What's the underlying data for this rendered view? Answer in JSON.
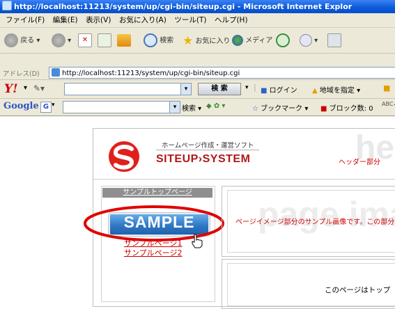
{
  "window": {
    "title": "http://localhost:11213/system/up/cgi-bin/siteup.cgi - Microsoft Internet Explor"
  },
  "menu": [
    "ファイル(F)",
    "編集(E)",
    "表示(V)",
    "お気に入り(A)",
    "ツール(T)",
    "ヘルプ(H)"
  ],
  "toolbar": {
    "back": "戻る",
    "search": "検索",
    "favorites": "お気に入り",
    "media": "メディア"
  },
  "address": {
    "label": "アドレス(D)",
    "url": "http://localhost:11213/system/up/cgi-bin/siteup.cgi"
  },
  "yahoo": {
    "logo": "Y!",
    "search_button": "検 索",
    "login": "ログイン",
    "region": "地域を指定"
  },
  "google": {
    "logo": "Google",
    "search": "検索",
    "bookmarks": "ブックマーク",
    "block_count": "ブロック数: 0"
  },
  "page": {
    "logo_tagline": "ホームページ作成・運営ソフト",
    "logo_name": "SITEUP›SYSTEM",
    "header_text": "ヘッダー部分",
    "header_watermark": "he",
    "nav_top": "サンプルトップページ",
    "sample_button": "SAMPLE",
    "nav_page1": "サンプルページ1",
    "nav_page2": "サンプルページ2",
    "image_watermark": "page ima",
    "image_caption": "ページイメージ部分のサンプル画像です。この部分",
    "body_text": "このページはトップ"
  },
  "colors": {
    "accent_red": "#d40000",
    "sample_blue": "#3a82c8",
    "highlight_ellipse": "#e00000"
  }
}
